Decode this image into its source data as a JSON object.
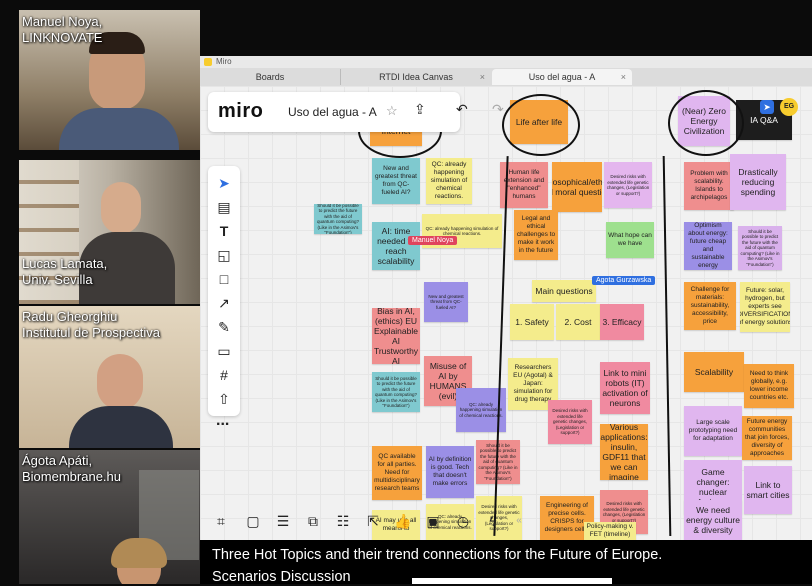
{
  "participants": [
    {
      "name": "Manuel Noya,\nLINKNOVATE",
      "bg": "#8a7a64"
    },
    {
      "name": "Lucas Lamata,\nUniv. Sevilla",
      "bg": "#7d7265"
    },
    {
      "name": "Radu Gheorghiu\nInstitutul de Prospectiva",
      "bg": "#b8a58a"
    },
    {
      "name": "Ágota Apáti,\nBiomembrane.hu",
      "bg": "#3b3a3a"
    }
  ],
  "window": {
    "title": "Miro"
  },
  "tabs": [
    {
      "label": "Boards"
    },
    {
      "label": "RTDI Idea Canvas",
      "close": "×"
    },
    {
      "label": "Uso del agua - A",
      "close": "×"
    }
  ],
  "topbar": {
    "logo": "miro",
    "board_name": "Uso del agua - A",
    "star": "☆"
  },
  "toolbar": {
    "more": "..."
  },
  "notes": {
    "n01": "Internet",
    "n02": "Life after life",
    "n03": "(Near) Zero Energy Civilization",
    "n04": "IA Q&A",
    "n05": "New and greatest threat from QC-fueled AI?",
    "n06": "QC: already happening simulation of chemical reactions.",
    "n07": "Human life extension and \"enhanced\" humans",
    "n08": "Philosophical/ethical and moral questions",
    "n09": "Desired risks with extended life genetic changes, (Legislation or support?)",
    "n10": "Problem with scalability. Islands to archipelagos",
    "n11": "Drastically reducing spending",
    "n12": "Should it be possible to predict the future with the aid of quantum computing? (Like in the Asimov's \"Foundation\")",
    "n13": "AI: time needed to reach scalability",
    "n14": "Legal and ethical challenges to make it work in the future",
    "n15": "What hope can we have",
    "n16": "Optimism about energy: future cheap and sustainable energy",
    "n17": "Main questions",
    "n18": "1. Safety",
    "n19": "2. Cost",
    "n20": "3. Efficacy",
    "n21": "Bias in AI, (ethics) EU Explainable AI Trustworthy AI",
    "n22": "Misuse of AI by HUMANS (evil)",
    "n23": "Researchers EU (Agotal) & Japan: simulation for drug therapy",
    "n24": "Link to mini robots (IT) activation of neurons",
    "n25": "Challenge for materials: sustainability, accessibility, price",
    "n26": "Scalability",
    "n27": "Need to think globally, e.g. lower income countries etc.",
    "n28": "QC available for all parties. Need for multidisciplinary research teams",
    "n29": "AI by definition is good. Tech that doesn't make errors",
    "n30": "Various applications: insulin, GDF11 that we can imagine",
    "n31": "Large scale prototyping need for adaptation",
    "n32": "Game changer: nuclear fusion...",
    "n33": "Link to smart cities",
    "n34": "AI may use all means to",
    "n35": "Engineering of precise cells. CRISPS for designers cells.",
    "n36": "Policy-making v. FET (timeline)",
    "n37": "We need energy culture & diversity",
    "n38": "Future energy communities that join forces, diversity of approaches",
    "n39": "Future: solar, hydrogen, but experts see DIVERSIFICATION of energy solutions"
  },
  "cursors": [
    {
      "label": "Manuel Noya",
      "color": "#e0445d"
    },
    {
      "label": "Agota Gurzawska",
      "color": "#2f6fe0"
    }
  ],
  "user_avatar": "EG",
  "caption": {
    "line1": "Three Hot Topics and their trend connections for the Future of Europe.",
    "line2": "Scenarios Discussion"
  }
}
